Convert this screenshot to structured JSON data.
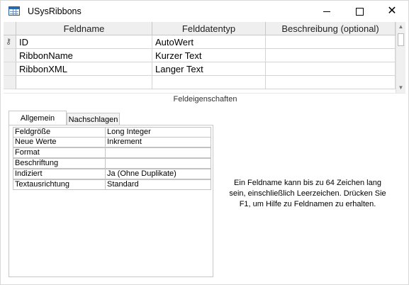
{
  "window": {
    "title": "USysRibbons"
  },
  "grid": {
    "columns": [
      "Feldname",
      "Felddatentyp",
      "Beschreibung (optional)"
    ],
    "rows": [
      {
        "name": "ID",
        "type": "AutoWert",
        "description": "",
        "primary_key": true
      },
      {
        "name": "RibbonName",
        "type": "Kurzer Text",
        "description": "",
        "primary_key": false
      },
      {
        "name": "RibbonXML",
        "type": "Langer Text",
        "description": "",
        "primary_key": false
      }
    ]
  },
  "properties": {
    "section_label": "Feldeigenschaften",
    "tabs": [
      "Allgemein",
      "Nachschlagen"
    ],
    "active_tab": "Allgemein",
    "rows": [
      {
        "name": "Feldgröße",
        "value": "Long Integer"
      },
      {
        "name": "Neue Werte",
        "value": "Inkrement"
      },
      {
        "name": "Format",
        "value": ""
      },
      {
        "name": "Beschriftung",
        "value": ""
      },
      {
        "name": "Indiziert",
        "value": "Ja (Ohne Duplikate)"
      },
      {
        "name": "Textausrichtung",
        "value": "Standard"
      }
    ]
  },
  "help_text": "Ein Feldname kann bis zu 64 Zeichen lang sein, einschließlich Leerzeichen. Drücken Sie F1, um Hilfe zu Feldnamen zu erhalten.",
  "icons": {
    "title": "table-icon",
    "minimize": "minimize-icon",
    "maximize": "maximize-icon",
    "close": "close-icon",
    "key": "primary-key-icon"
  }
}
